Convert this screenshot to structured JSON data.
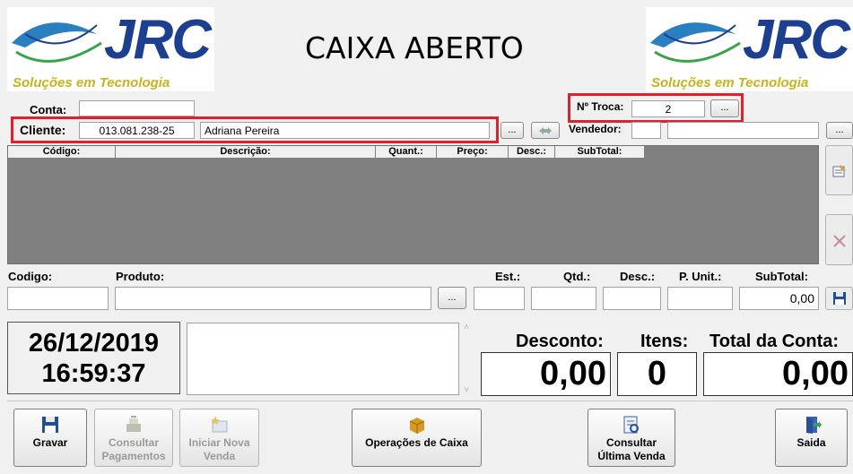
{
  "header": {
    "title": "CAIXA ABERTO",
    "logo_brand": "JRC",
    "logo_tagline": "Soluções em Tecnologia"
  },
  "conta": {
    "label": "Conta:",
    "value": ""
  },
  "troca": {
    "label": "Nº Troca:",
    "value": "2",
    "button": "..."
  },
  "cliente": {
    "label": "Cliente:",
    "code": "013.081.238-25",
    "name": "Adriana Pereira",
    "button": "..."
  },
  "vendedor": {
    "label": "Vendedor:",
    "code": "",
    "name": "",
    "button": "..."
  },
  "grid": {
    "columns": [
      "Código:",
      "Descrição:",
      "Quant.:",
      "Preço:",
      "Desc.:",
      "SubTotal:"
    ]
  },
  "entry": {
    "codigo_label": "Codigo:",
    "produto_label": "Produto:",
    "produto_button": "...",
    "est_label": "Est.:",
    "qtd_label": "Qtd.:",
    "desc_label": "Desc.:",
    "unit_label": "P. Unit.:",
    "subtotal_label": "SubTotal:",
    "subtotal_value": "0,00"
  },
  "clock": {
    "date": "26/12/2019",
    "time": "16:59:37"
  },
  "totals": {
    "desconto_label": "Desconto:",
    "desconto_value": "0,00",
    "itens_label": "Itens:",
    "itens_value": "0",
    "total_label": "Total da Conta:",
    "total_value": "0,00"
  },
  "toolbar": {
    "gravar": "Gravar",
    "consultar_pagamentos_1": "Consultar",
    "consultar_pagamentos_2": "Pagamentos",
    "iniciar_1": "Iniciar Nova",
    "iniciar_2": "Venda",
    "operacoes": "Operações de Caixa",
    "ultima_1": "Consultar",
    "ultima_2": "Última Venda",
    "saida": "Saida"
  },
  "colors": {
    "highlight": "#e0202a",
    "brand": "#1d3f8f",
    "tagline": "#c9b316"
  }
}
